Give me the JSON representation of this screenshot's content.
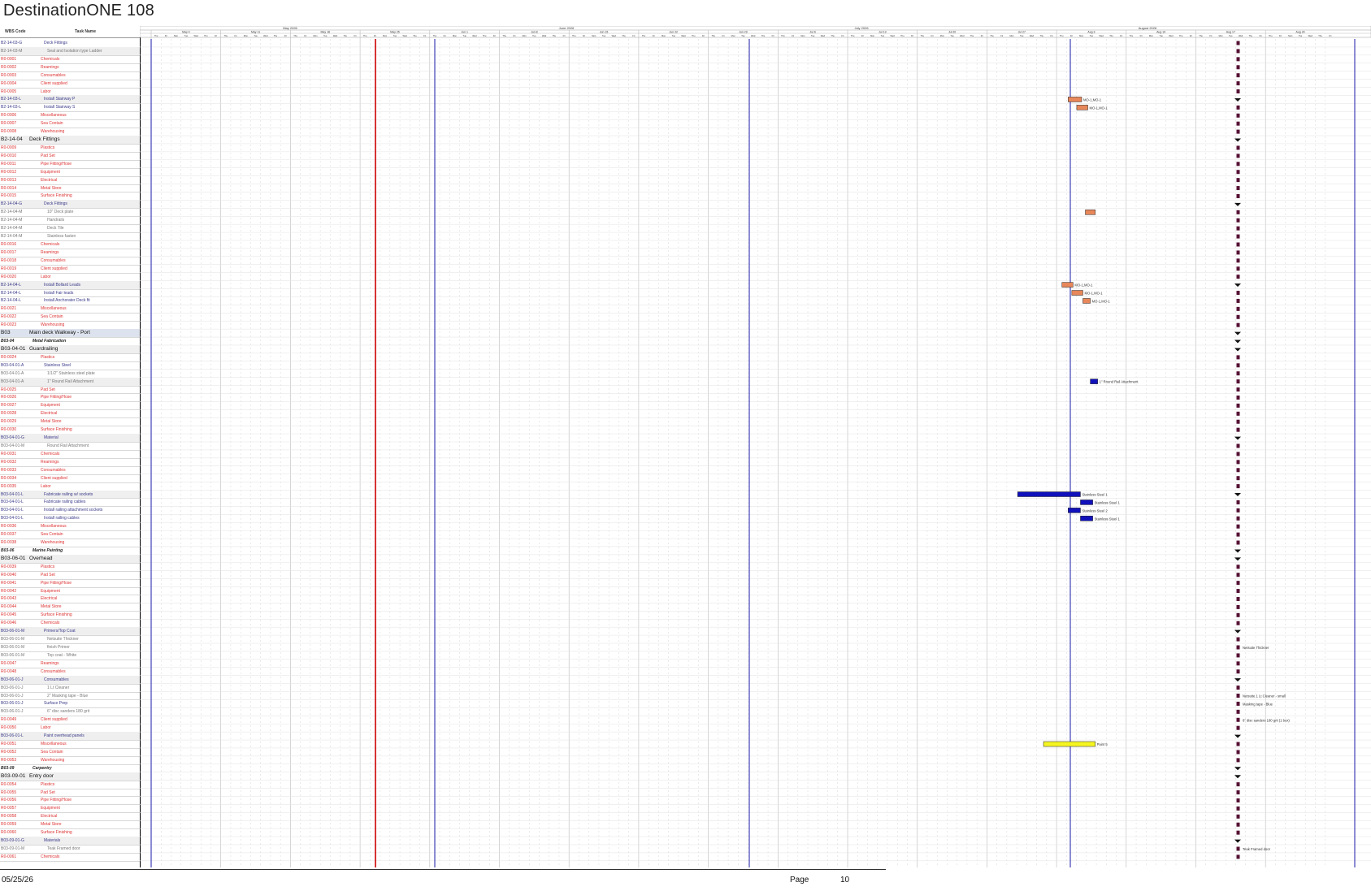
{
  "title": "DestinationONE 108",
  "table_headers": {
    "code": "WBS Code",
    "name": "Task Name"
  },
  "timescale": {
    "months": [
      "May 2026",
      "June 2026",
      "July 2026",
      "August 2026"
    ],
    "weeks": [
      "May 4",
      "May 11",
      "May 18",
      "May 25",
      "Jun 1",
      "Jun 8",
      "Jun 15",
      "Jun 22",
      "Jun 29",
      "Jul 6",
      "Jul 13",
      "Jul 20",
      "Jul 27",
      "Aug 3",
      "Aug 10",
      "Aug 17",
      "Aug 24"
    ],
    "days": [
      "Thu",
      "Fri",
      "Mon",
      "Tue",
      "Wed",
      "Thu",
      "Fri"
    ]
  },
  "colors": {
    "today_line": "#cc0000",
    "page_line": "#1a1aaa",
    "bar_orange": "#e8875a",
    "bar_blue": "#1111bb",
    "bar_yellow": "#f5f522",
    "milestone": "#551133"
  },
  "rows": [
    {
      "code": "B2-14-03-G",
      "name": "Deck Fittings",
      "lvl": "task"
    },
    {
      "code": "B2-14-03-M",
      "name": "Seal and Isolation type Ladder",
      "lvl": "sub",
      "gray": true
    },
    {
      "code": "R0-0001",
      "name": "Chemicals",
      "lvl": "res"
    },
    {
      "code": "R0-0002",
      "name": "Reamings",
      "lvl": "res"
    },
    {
      "code": "R0-0003",
      "name": "Consumables",
      "lvl": "res"
    },
    {
      "code": "R0-0004",
      "name": "Client supplied",
      "lvl": "res"
    },
    {
      "code": "R0-0005",
      "name": "Labor",
      "lvl": "res"
    },
    {
      "code": "B2-14-03-L",
      "name": "Install Stairway P",
      "lvl": "task",
      "gray": true
    },
    {
      "code": "B2-14-03-L",
      "name": "Install Stairway S",
      "lvl": "task"
    },
    {
      "code": "R0-0006",
      "name": "Miscellaneous",
      "lvl": "res"
    },
    {
      "code": "R0-0007",
      "name": "Sea Contain",
      "lvl": "res"
    },
    {
      "code": "R0-0008",
      "name": "Warehousing",
      "lvl": "res"
    },
    {
      "code": "B2-14-04",
      "name": "Deck Fittings",
      "lvl": "sum0",
      "gray": true
    },
    {
      "code": "R0-0009",
      "name": "Plastics",
      "lvl": "res"
    },
    {
      "code": "R0-0010",
      "name": "Pad Set",
      "lvl": "res"
    },
    {
      "code": "R0-0011",
      "name": "Pipe Fitting/Hose",
      "lvl": "res"
    },
    {
      "code": "R0-0012",
      "name": "Equipment",
      "lvl": "res"
    },
    {
      "code": "R0-0013",
      "name": "Electrical",
      "lvl": "res"
    },
    {
      "code": "R0-0014",
      "name": "Metal Store",
      "lvl": "res"
    },
    {
      "code": "R0-0015",
      "name": "Surface Finishing",
      "lvl": "res"
    },
    {
      "code": "B2-14-04-G",
      "name": "Deck Fittings",
      "lvl": "task",
      "gray": true
    },
    {
      "code": "B2-14-04-M",
      "name": "10\" Deck plate",
      "lvl": "sub"
    },
    {
      "code": "B2-14-04-M",
      "name": "Handrails",
      "lvl": "sub"
    },
    {
      "code": "B2-14-04-M",
      "name": "Deck Tile",
      "lvl": "sub"
    },
    {
      "code": "B2-14-04-M",
      "name": "Stainless fasten",
      "lvl": "sub"
    },
    {
      "code": "R0-0016",
      "name": "Chemicals",
      "lvl": "res"
    },
    {
      "code": "R0-0017",
      "name": "Reamings",
      "lvl": "res"
    },
    {
      "code": "R0-0018",
      "name": "Consumables",
      "lvl": "res"
    },
    {
      "code": "R0-0019",
      "name": "Client supplied",
      "lvl": "res"
    },
    {
      "code": "R0-0020",
      "name": "Labor",
      "lvl": "res"
    },
    {
      "code": "B2-14-04-L",
      "name": "Install Bollard Leads",
      "lvl": "task",
      "gray": true
    },
    {
      "code": "B2-14-04-L",
      "name": "Install Fair leads",
      "lvl": "task"
    },
    {
      "code": "B2-14-04-L",
      "name": "Install Anchorater Deck fit",
      "lvl": "task"
    },
    {
      "code": "R0-0021",
      "name": "Miscellaneous",
      "lvl": "res"
    },
    {
      "code": "R0-0022",
      "name": "Sea Contain",
      "lvl": "res"
    },
    {
      "code": "R0-0023",
      "name": "Warehousing",
      "lvl": "res"
    },
    {
      "code": "B03",
      "name": "Main deck Walkway - Port",
      "lvl": "sum0",
      "hl": true
    },
    {
      "code": "B03-04",
      "name": "Metal Fabrication",
      "lvl": "sum1"
    },
    {
      "code": "B03-04-01",
      "name": "Guardrailing",
      "lvl": "sum0",
      "gray": true
    },
    {
      "code": "R0-0024",
      "name": "Plastics",
      "lvl": "res"
    },
    {
      "code": "B03-04-01-A",
      "name": "Stainless Steel",
      "lvl": "task"
    },
    {
      "code": "B03-04-01-A",
      "name": "1/1/2\" Stainless steel plate",
      "lvl": "sub"
    },
    {
      "code": "B03-04-01-A",
      "name": "1\" Round Rail Attachment",
      "lvl": "sub",
      "gray": true
    },
    {
      "code": "R0-0025",
      "name": "Pad Set",
      "lvl": "res"
    },
    {
      "code": "R0-0026",
      "name": "Pipe Fitting/Hose",
      "lvl": "res"
    },
    {
      "code": "R0-0027",
      "name": "Equipment",
      "lvl": "res"
    },
    {
      "code": "R0-0028",
      "name": "Electrical",
      "lvl": "res"
    },
    {
      "code": "R0-0029",
      "name": "Metal Store",
      "lvl": "res"
    },
    {
      "code": "R0-0030",
      "name": "Surface Finishing",
      "lvl": "res"
    },
    {
      "code": "B03-04-01-G",
      "name": "Material",
      "lvl": "task",
      "gray": true
    },
    {
      "code": "B03-04-01-M",
      "name": "Round Rail Attachment",
      "lvl": "sub"
    },
    {
      "code": "R0-0031",
      "name": "Chemicals",
      "lvl": "res"
    },
    {
      "code": "R0-0032",
      "name": "Reamings",
      "lvl": "res"
    },
    {
      "code": "R0-0033",
      "name": "Consumables",
      "lvl": "res"
    },
    {
      "code": "R0-0034",
      "name": "Client supplied",
      "lvl": "res"
    },
    {
      "code": "R0-0035",
      "name": "Labor",
      "lvl": "res"
    },
    {
      "code": "B03-04-01-L",
      "name": "Fabricate railing w/ sockets",
      "lvl": "task",
      "gray": true
    },
    {
      "code": "B03-04-01-L",
      "name": "Fabricate railing cables",
      "lvl": "task"
    },
    {
      "code": "B03-04-01-L",
      "name": "Install railing attachment sockets",
      "lvl": "task"
    },
    {
      "code": "B03-04-01-L",
      "name": "Install railing cables",
      "lvl": "task"
    },
    {
      "code": "R0-0036",
      "name": "Miscellaneous",
      "lvl": "res"
    },
    {
      "code": "R0-0037",
      "name": "Sea Contain",
      "lvl": "res"
    },
    {
      "code": "R0-0038",
      "name": "Warehousing",
      "lvl": "res"
    },
    {
      "code": "B03-06",
      "name": "Marine Painting",
      "lvl": "sum1"
    },
    {
      "code": "B03-06-01",
      "name": "Overhead",
      "lvl": "sum0",
      "gray": true
    },
    {
      "code": "R0-0039",
      "name": "Plastics",
      "lvl": "res"
    },
    {
      "code": "R0-0040",
      "name": "Pad Set",
      "lvl": "res"
    },
    {
      "code": "R0-0041",
      "name": "Pipe Fitting/Hose",
      "lvl": "res"
    },
    {
      "code": "R0-0042",
      "name": "Equipment",
      "lvl": "res"
    },
    {
      "code": "R0-0043",
      "name": "Electrical",
      "lvl": "res"
    },
    {
      "code": "R0-0044",
      "name": "Metal Store",
      "lvl": "res"
    },
    {
      "code": "R0-0045",
      "name": "Surface Finishing",
      "lvl": "res"
    },
    {
      "code": "R0-0046",
      "name": "Chemicals",
      "lvl": "res"
    },
    {
      "code": "B03-06-01-M",
      "name": "Primers/Top Coat",
      "lvl": "task",
      "gray": true
    },
    {
      "code": "B03-06-01-M",
      "name": "Netsuite Thickner",
      "lvl": "sub"
    },
    {
      "code": "B03-06-01-M",
      "name": "finish Primer",
      "lvl": "sub"
    },
    {
      "code": "B03-06-01-M",
      "name": "Top coat - White",
      "lvl": "sub"
    },
    {
      "code": "R0-0047",
      "name": "Reamings",
      "lvl": "res"
    },
    {
      "code": "R0-0048",
      "name": "Consumables",
      "lvl": "res"
    },
    {
      "code": "B03-06-01-J",
      "name": "Consumables",
      "lvl": "task",
      "gray": true
    },
    {
      "code": "B03-06-01-J",
      "name": "1 Lt Cleaner",
      "lvl": "sub"
    },
    {
      "code": "B03-06-01-J",
      "name": "2\" Masking tape - Blue",
      "lvl": "sub"
    },
    {
      "code": "B03-06-01-J",
      "name": "Surface Prep",
      "lvl": "task"
    },
    {
      "code": "B03-06-01-J",
      "name": "6\" disc sanders 180 grit",
      "lvl": "sub"
    },
    {
      "code": "R0-0049",
      "name": "Client supplied",
      "lvl": "res"
    },
    {
      "code": "R0-0050",
      "name": "Labor",
      "lvl": "res"
    },
    {
      "code": "B03-06-01-L",
      "name": "Paint overhead panels",
      "lvl": "task",
      "gray": true
    },
    {
      "code": "R0-0051",
      "name": "Miscellaneous",
      "lvl": "res"
    },
    {
      "code": "R0-0052",
      "name": "Sea Contain",
      "lvl": "res"
    },
    {
      "code": "R0-0053",
      "name": "Warehousing",
      "lvl": "res"
    },
    {
      "code": "B03-09",
      "name": "Carpentry",
      "lvl": "sum1"
    },
    {
      "code": "B03-09-01",
      "name": "Entry door",
      "lvl": "sum0",
      "gray": true
    },
    {
      "code": "R0-0054",
      "name": "Plastics",
      "lvl": "res"
    },
    {
      "code": "R0-0055",
      "name": "Pad Set",
      "lvl": "res"
    },
    {
      "code": "R0-0056",
      "name": "Pipe Fitting/Hose",
      "lvl": "res"
    },
    {
      "code": "R0-0057",
      "name": "Equipment",
      "lvl": "res"
    },
    {
      "code": "R0-0058",
      "name": "Electrical",
      "lvl": "res"
    },
    {
      "code": "R0-0059",
      "name": "Metal Store",
      "lvl": "res"
    },
    {
      "code": "R0-0060",
      "name": "Surface Finishing",
      "lvl": "res"
    },
    {
      "code": "B03-09-01-G",
      "name": "Materials",
      "lvl": "task",
      "gray": true
    },
    {
      "code": "B03-09-01-M",
      "name": "Teak Framed door",
      "lvl": "sub"
    },
    {
      "code": "R0-0061",
      "name": "Chemicals",
      "lvl": "res"
    }
  ],
  "bars": [
    {
      "row": 7,
      "x0": 0.754,
      "x1": 0.765,
      "color": "orange",
      "label": "MO-1,MO-1"
    },
    {
      "row": 8,
      "x0": 0.761,
      "x1": 0.77,
      "color": "orange",
      "label": "MO-1,MO-1"
    },
    {
      "row": 21,
      "x0": 0.768,
      "x1": 0.776,
      "color": "orange",
      "label": ""
    },
    {
      "row": 30,
      "x0": 0.749,
      "x1": 0.758,
      "color": "orange",
      "label": "MO-1,MO-1"
    },
    {
      "row": 31,
      "x0": 0.757,
      "x1": 0.766,
      "color": "orange",
      "label": "MO-1,MO-1"
    },
    {
      "row": 32,
      "x0": 0.766,
      "x1": 0.772,
      "color": "orange",
      "label": "MO-1,MO-1"
    },
    {
      "row": 42,
      "x0": 0.772,
      "x1": 0.778,
      "color": "blue",
      "label": "1\" Round Rail Attachment"
    },
    {
      "row": 56,
      "x0": 0.713,
      "x1": 0.764,
      "color": "blue",
      "label": "Stainless Steel 1"
    },
    {
      "row": 57,
      "x0": 0.764,
      "x1": 0.774,
      "color": "blue",
      "label": "Stainless Steel 1"
    },
    {
      "row": 58,
      "x0": 0.754,
      "x1": 0.764,
      "color": "blue",
      "label": "Stainless Steel 2"
    },
    {
      "row": 59,
      "x0": 0.764,
      "x1": 0.774,
      "color": "blue",
      "label": "Stainless Steel 1"
    },
    {
      "row": 87,
      "x0": 0.734,
      "x1": 0.776,
      "color": "yellow",
      "label": "Paint 5"
    }
  ],
  "extra_labels": [
    {
      "row": 75,
      "label": "Netsuite Thickner"
    },
    {
      "row": 81,
      "label": "Netsuite 1 Lt Cleaner - small"
    },
    {
      "row": 82,
      "label": "Masking tape - Blue"
    },
    {
      "row": 84,
      "label": "6\" disc sanders 180 grit (1 box)"
    },
    {
      "row": 100,
      "label": "Teak Framed door"
    }
  ],
  "footer": {
    "date": "05/25/26",
    "page_label": "Page",
    "page_number": "10"
  }
}
